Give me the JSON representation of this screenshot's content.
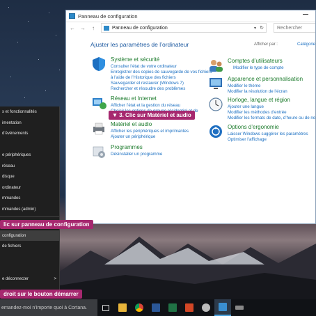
{
  "window": {
    "title": "Panneau de configuration",
    "breadcrumb": "Panneau de configuration",
    "search_placeholder": "Rechercher",
    "heading": "Ajuster les paramètres de l’ordinateur",
    "view_by_label": "Afficher par :",
    "view_by_value": "Catégorie"
  },
  "categories": [
    {
      "title": "Système et sécurité",
      "links": [
        "Consulter l’état de votre ordinateur",
        "Enregistrer des copies de sauvegarde de vos fichiers",
        "à l’aide de l’Historique des fichiers",
        "Sauvegarder et restaurer (Windows 7)",
        "Rechercher et résoudre des problèmes"
      ]
    },
    {
      "title": "Réseau et Internet",
      "links": [
        "Afficher l’état et la gestion du réseau",
        "Choisir les options de groupe résidentiel et de"
      ]
    },
    {
      "title": "Matériel et audio",
      "links": [
        "Afficher les périphériques et imprimantes",
        "Ajouter un périphérique"
      ]
    },
    {
      "title": "Programmes",
      "links": [
        "Désinstaller un programme"
      ]
    },
    {
      "title": "Comptes d’utilisateurs",
      "links": [
        "Modifier le type de compte"
      ]
    },
    {
      "title": "Apparence et personnalisation",
      "links": [
        "Modifier le thème",
        "Modifier la résolution de l’écran"
      ]
    },
    {
      "title": "Horloge, langue et région",
      "links": [
        "Ajouter une langue",
        "Modifier les méthodes d’entrée",
        "Modifier les formats de date, d’heure ou de nombre"
      ]
    },
    {
      "title": "Options d’ergonomie",
      "links": [
        "Laisser Windows suggérer les paramètres",
        "Optimiser l’affichage"
      ]
    }
  ],
  "winx_menu": {
    "items": [
      "s et fonctionnalités",
      "imentation",
      "d’événements",
      "",
      "e périphériques",
      "réseau",
      "disque",
      "ordinateur",
      "mmandes",
      "mmandes (admin)",
      "",
      "",
      "configuration",
      "de fichiers",
      "",
      "",
      "e déconnecter",
      ""
    ],
    "submenu_arrow": ">"
  },
  "callouts": {
    "step1": "droit sur le bouton démarrer",
    "step2": "lic sur panneau de configuration",
    "step3": "▼ 3. Clic sur Matériel et audio"
  },
  "taskbar": {
    "cortana_text": "emandez-moi n’importe quoi à Cortana.",
    "icons": [
      "task-view-icon",
      "file-explorer-icon",
      "chrome-icon",
      "word-icon",
      "excel-icon",
      "powerpoint-icon",
      "app-icon",
      "control-panel-icon",
      "storage-icon"
    ]
  },
  "colors": {
    "callout": "#a6286f",
    "category_title": "#1b7a2b",
    "link": "#1a6fc2",
    "heading": "#1e5aa0"
  }
}
